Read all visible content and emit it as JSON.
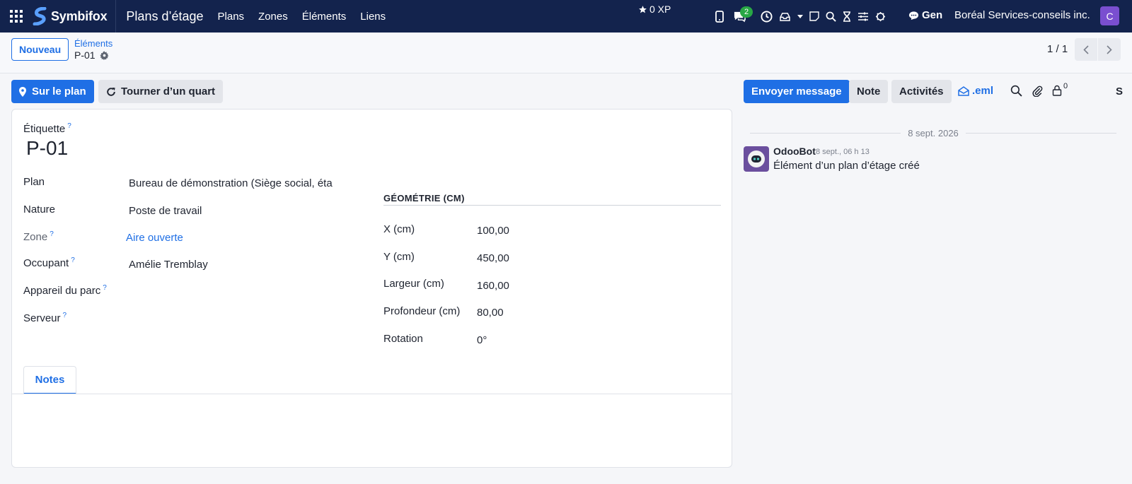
{
  "navbar": {
    "brand": "Symbifox",
    "app_title": "Plans d’étage",
    "menu": [
      "Plans",
      "Zones",
      "Éléments",
      "Liens"
    ],
    "xp": "0 XP",
    "messages_badge": "2",
    "gen": "Gen",
    "company": "Boréal Services-conseils inc.",
    "user_initial": "C"
  },
  "control": {
    "new_button": "Nouveau",
    "breadcrumb_parent": "Éléments",
    "breadcrumb_current": "P-01",
    "pager": "1 / 1"
  },
  "actions": {
    "on_plan": "Sur le plan",
    "rotate": "Tourner d’un quart",
    "send_message": "Envoyer message",
    "note": "Note",
    "activities": "Activités",
    "eml": ".eml",
    "followers_count": "0",
    "overflow_letter": "S"
  },
  "form": {
    "title_label": "Étiquette",
    "title_value": "P-01",
    "help_mark": "?",
    "fields": {
      "plan": {
        "label": "Plan",
        "value": "Bureau de démonstration (Siège social, éta"
      },
      "nature": {
        "label": "Nature",
        "value": "Poste de travail"
      },
      "zone": {
        "label": "Zone",
        "value": "Aire ouverte"
      },
      "occupant": {
        "label": "Occupant",
        "value": "Amélie Tremblay"
      },
      "device": {
        "label": "Appareil du parc",
        "value": ""
      },
      "server": {
        "label": "Serveur",
        "value": ""
      }
    },
    "geometry": {
      "heading": "GÉOMÉTRIE (CM)",
      "x": {
        "label": "X (cm)",
        "value": "100,00"
      },
      "y": {
        "label": "Y (cm)",
        "value": "450,00"
      },
      "width": {
        "label": "Largeur (cm)",
        "value": "160,00"
      },
      "depth": {
        "label": "Profondeur (cm)",
        "value": "80,00"
      },
      "rotation": {
        "label": "Rotation",
        "value": "0°"
      }
    },
    "tabs": [
      "Notes"
    ]
  },
  "chatter": {
    "date_separator": "8 sept. 2026",
    "message": {
      "author": "OdooBot",
      "date": "8 sept., 06 h 13",
      "body": "Élément d’un plan d’étage créé"
    }
  },
  "colors": {
    "navbar": "#13234d",
    "primary": "#1f6fe5",
    "avatar": "#7a4fd0",
    "badge": "#28a745"
  }
}
